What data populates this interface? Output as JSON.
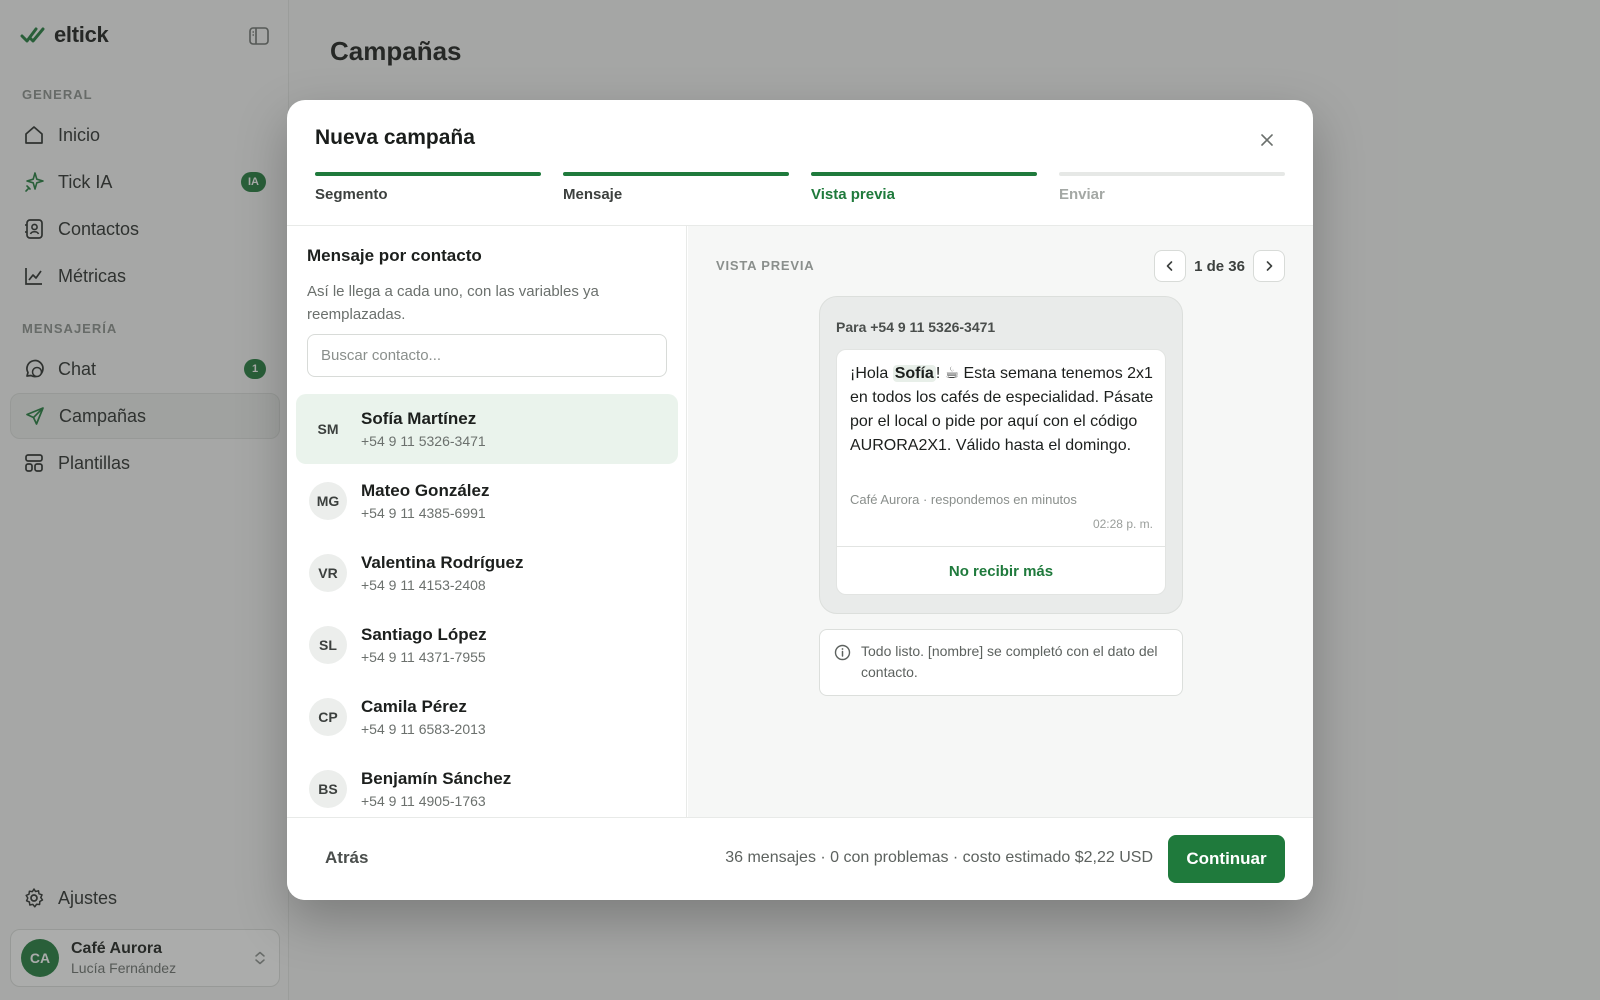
{
  "app": {
    "brand_name": "eltick",
    "page_title": "Campañas"
  },
  "sidebar": {
    "sections": [
      {
        "label": "GENERAL"
      },
      {
        "label": "MENSAJERÍA"
      }
    ],
    "items": [
      {
        "label": "Inicio",
        "icon": "home-icon"
      },
      {
        "label": "Tick IA",
        "icon": "sparkle-icon",
        "badge": "IA"
      },
      {
        "label": "Contactos",
        "icon": "contacts-icon"
      },
      {
        "label": "Métricas",
        "icon": "chart-icon"
      },
      {
        "label": "Chat",
        "icon": "chat-icon",
        "badge": "1"
      },
      {
        "label": "Campañas",
        "icon": "send-icon",
        "active": true
      },
      {
        "label": "Plantillas",
        "icon": "templates-icon"
      }
    ],
    "settings_label": "Ajustes",
    "account": {
      "initials": "CA",
      "name": "Café Aurora",
      "user": "Lucía Fernández"
    }
  },
  "modal": {
    "title": "Nueva campaña",
    "steps": [
      {
        "label": "Segmento",
        "state": "done"
      },
      {
        "label": "Mensaje",
        "state": "done"
      },
      {
        "label": "Vista previa",
        "state": "current"
      },
      {
        "label": "Enviar",
        "state": "todo"
      }
    ],
    "left": {
      "title": "Mensaje por contacto",
      "subtitle": "Así le llega a cada uno, con las variables ya reemplazadas.",
      "search_placeholder": "Buscar contacto...",
      "contacts": [
        {
          "initials": "SM",
          "name": "Sofía Martínez",
          "phone": "+54 9 11 5326-3471",
          "selected": true
        },
        {
          "initials": "MG",
          "name": "Mateo González",
          "phone": "+54 9 11 4385-6991"
        },
        {
          "initials": "VR",
          "name": "Valentina Rodríguez",
          "phone": "+54 9 11 4153-2408"
        },
        {
          "initials": "SL",
          "name": "Santiago López",
          "phone": "+54 9 11 4371-7955"
        },
        {
          "initials": "CP",
          "name": "Camila Pérez",
          "phone": "+54 9 11 6583-2013"
        },
        {
          "initials": "BS",
          "name": "Benjamín Sánchez",
          "phone": "+54 9 11 4905-1763"
        }
      ]
    },
    "preview": {
      "label": "VISTA PREVIA",
      "pager_text": "1 de 36",
      "to_line": "Para +54 9 11 5326-3471",
      "message_prefix": "¡Hola ",
      "message_var": "Sofía",
      "message_suffix": "! ☕ Esta semana tenemos 2x1 en todos los cafés de especialidad. Pásate por el local o pide por aquí con el código AURORA2X1. Válido hasta el domingo.",
      "footer": "Café Aurora · respondemos en minutos",
      "time": "02:28 p. m.",
      "cta": "No recibir más",
      "info": "Todo listo. [nombre] se completó con el dato del contacto."
    },
    "footer": {
      "back_label": "Atrás",
      "summary": "36 mensajes · 0 con problemas · costo estimado $2,22 USD",
      "continue_label": "Continuar"
    }
  },
  "colors": {
    "accent": "#1f7a3c",
    "overlay": "#373a38"
  }
}
